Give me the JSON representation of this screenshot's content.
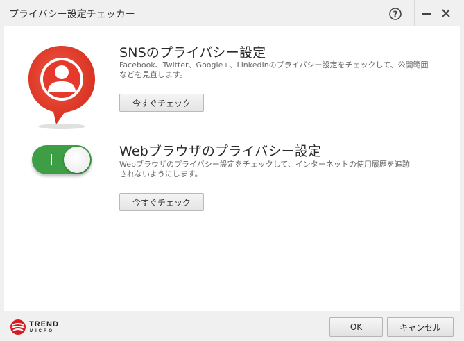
{
  "window": {
    "title": "プライバシー設定チェッカー",
    "help_symbol": "?"
  },
  "sns": {
    "title": "SNSのプライバシー設定",
    "description_line1": "Facebook、Twitter、Google+、LinkedInのプライバシー設定をチェックして、公開範囲",
    "description_line2": "などを見直します。",
    "button": "今すぐチェック"
  },
  "web": {
    "title": "Webブラウザのプライバシー設定",
    "description_line1": "Webブラウザのプライバシー設定をチェックして、インターネットの使用履歴を追跡",
    "description_line2": "されないようにします。",
    "button": "今すぐチェック",
    "toggle_on": true
  },
  "footer": {
    "logo_line1": "TREND",
    "logo_line2": "MICRO",
    "ok": "OK",
    "cancel": "キャンセル"
  },
  "colors": {
    "accent_red": "#e53a2b",
    "toggle_green": "#3e9e45"
  }
}
